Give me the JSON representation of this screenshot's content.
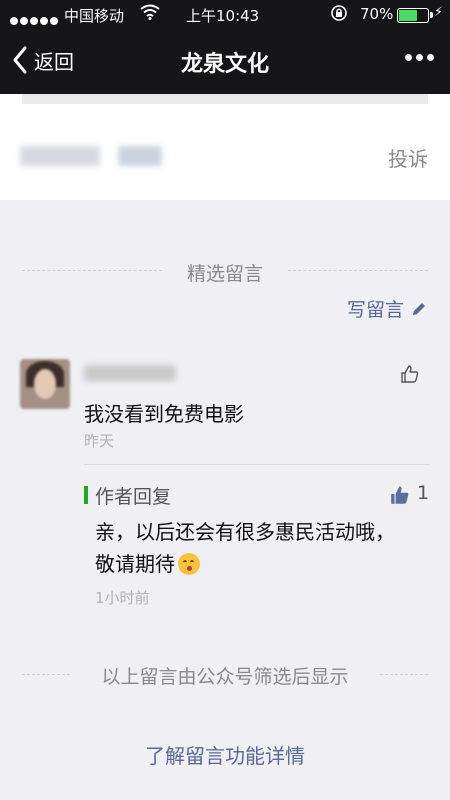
{
  "status_bar": {
    "carrier": "中国移动",
    "time": "上午10:43",
    "battery_percent": "70%",
    "battery_level": 0.7,
    "signal_icon": "signal-dots-icon",
    "wifi_icon": "wifi-icon",
    "lock_icon": "rotation-lock-icon",
    "charging_icon": "bolt-icon"
  },
  "nav": {
    "back_label": "返回",
    "title": "龙泉文化",
    "more_icon": "more-dots-icon"
  },
  "article_footer": {
    "report_label": "投诉"
  },
  "comments_section": {
    "title": "精选留言",
    "write_label": "写留言",
    "write_icon": "pencil-icon"
  },
  "comment": {
    "text": "我没看到免费电影",
    "time": "昨天",
    "like_icon": "thumbs-up-outline-icon",
    "reply": {
      "label": "作者回复",
      "like_count": "1",
      "like_icon": "thumbs-up-filled-icon",
      "text": "亲，以后还会有很多惠民活动哦，敬请期待",
      "emoji": "kissing-face-emoji",
      "time": "1小时前"
    }
  },
  "footer": {
    "note": "以上留言由公众号筛选后显示",
    "learn_more": "了解留言功能详情"
  },
  "colors": {
    "nav_bg": "#161618",
    "link_blue": "#576b95",
    "reply_green": "#1aad19",
    "page_bg": "#efeff4"
  }
}
